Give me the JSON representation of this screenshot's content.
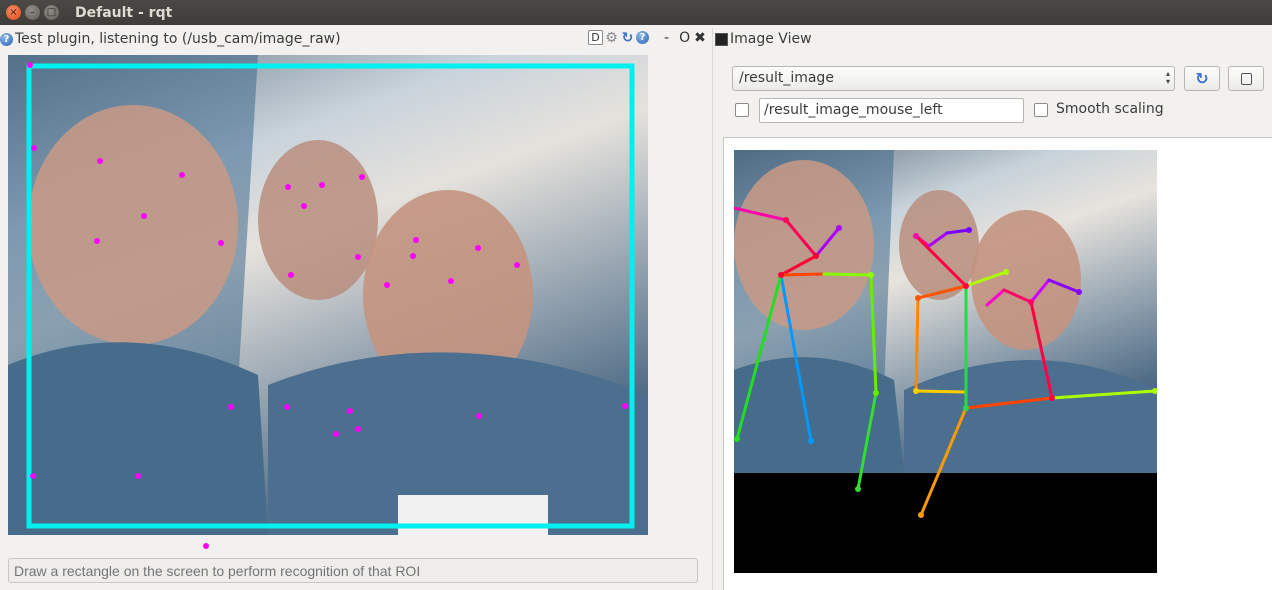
{
  "window": {
    "title": "Default - rqt",
    "close_glyph": "×",
    "min_glyph": "–",
    "max_glyph": "□"
  },
  "left_plugin": {
    "help_glyph": "?",
    "title": "Test plugin, listening to (/usb_cam/image_raw)",
    "d_label": "D",
    "gear_glyph": "⚙",
    "reload_glyph": "↻",
    "help2_glyph": "?",
    "dash": "-",
    "o": "O",
    "x": "✖",
    "status_placeholder": "Draw a rectangle on the screen to perform recognition of that ROI"
  },
  "right_plugin": {
    "title": "Image View",
    "topic": "/result_image",
    "select_arrow_up": "▴",
    "select_arrow_down": "▾",
    "refresh_glyph": "↻",
    "mouse_topic": "/result_image_mouse_left",
    "smooth_label": "Smooth scaling",
    "mouse_checked": false,
    "smooth_checked": false
  },
  "colors": {
    "roi": "#00f0f0",
    "keypoint": "#ff00ff"
  }
}
